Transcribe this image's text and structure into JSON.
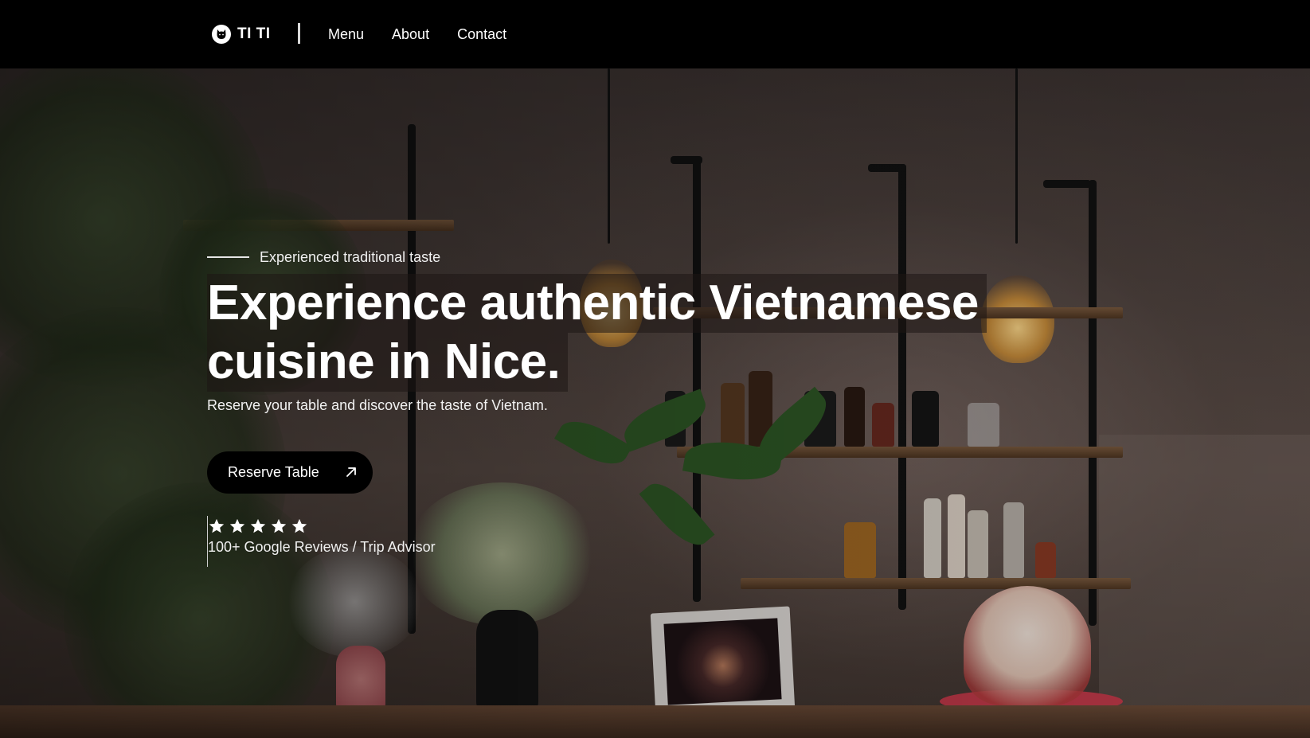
{
  "nav": {
    "logo_text": "TI TI",
    "links": [
      {
        "label": "Menu"
      },
      {
        "label": "About"
      },
      {
        "label": "Contact"
      }
    ]
  },
  "hero": {
    "eyebrow": "Experienced traditional taste",
    "headline_line1": "Experience authentic Vietnamese",
    "headline_line2": "cuisine in Nice.",
    "subtitle": "Reserve your table and discover the taste of Vietnam.",
    "cta_label": "Reserve Table",
    "rating": {
      "stars": 5,
      "reviews_text": "100+ Google Reviews / Trip Advisor"
    },
    "background_image": "restaurant-bar-interior"
  },
  "colors": {
    "nav_background": "#000000",
    "text": "#ffffff",
    "button_background": "#000000"
  },
  "icons": {
    "logo": "cat-face-icon",
    "cta": "arrow-up-right-icon",
    "rating": "star-icon"
  }
}
